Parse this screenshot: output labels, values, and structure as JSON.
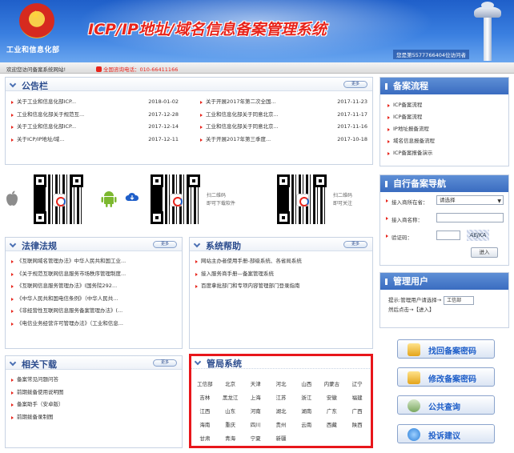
{
  "header": {
    "ministry": "工业和信息化部",
    "title": "ICP/IP地址/域名信息备案管理系统",
    "visitor_counter": "您是第5577766404位访问者"
  },
  "statusbar": {
    "welcome": "欢迎您访问备案系统网站!",
    "hotline_label": "全国咨询电话：",
    "hotline_number": "010-66411166"
  },
  "bulletin": {
    "title": "公告栏",
    "more": "更多",
    "left": [
      {
        "title": "关于工业和信息化部ICP...",
        "date": "2018-01-02"
      },
      {
        "title": "工业和信息化部关于规范互...",
        "date": "2017-12-28"
      },
      {
        "title": "关于工业和信息化部ICP...",
        "date": "2017-12-14"
      },
      {
        "title": "关于ICP/IP地址/域...",
        "date": "2017-12-11"
      }
    ],
    "right": [
      {
        "title": "关于开展2017年第二次全国...",
        "date": "2017-11-23"
      },
      {
        "title": "工业和信息化部关于同意北京...",
        "date": "2017-11-17"
      },
      {
        "title": "工业和信息化部关于同意北京...",
        "date": "2017-11-16"
      },
      {
        "title": "关于开展2017年第三季度...",
        "date": "2017-10-18"
      }
    ]
  },
  "qr": {
    "caption1_line1": "扫二维码",
    "caption1_line2": "即可下载软件",
    "caption2_line1": "扫二维码",
    "caption2_line2": "即可关注"
  },
  "laws": {
    "title": "法律法规",
    "more": "更多",
    "items": [
      "《互联网域名管理办法》中华人民共和国工业...",
      "《关于规范互联网信息服务市场秩序管理制度...",
      "《互联网信息服务管理办法》(国务院292...",
      "《中华人民共和国电信条例》（中华人民共...",
      "《非经营性互联网信息服务备案管理办法》(...",
      "《电信业务经营许可管理办法》（工业和信息..."
    ]
  },
  "help": {
    "title": "系统帮助",
    "more": "更多",
    "items": [
      "网站主办者使用手册-部级系统、各省局系统",
      "接入服务商手册—备案管理系统",
      "百度拿批部门和专项内容管理部门登录指南"
    ]
  },
  "downloads": {
    "title": "相关下载",
    "more": "更多",
    "items": [
      "备案常见问题问答",
      "前期拨备使用说明图",
      "备案助手（安卓版）",
      "前期拨备录制图"
    ]
  },
  "bureau": {
    "title": "管局系统",
    "provinces": [
      "工信部",
      "北京",
      "天津",
      "河北",
      "山西",
      "内蒙古",
      "辽宁",
      "吉林",
      "黑龙江",
      "上海",
      "江苏",
      "浙江",
      "安徽",
      "福建",
      "江西",
      "山东",
      "河南",
      "湖北",
      "湖南",
      "广东",
      "广西",
      "海南",
      "重庆",
      "四川",
      "贵州",
      "云南",
      "西藏",
      "陕西",
      "甘肃",
      "青海",
      "宁夏",
      "新疆"
    ]
  },
  "flow": {
    "title": "备案流程",
    "items": [
      "ICP备案流程",
      "ICP备案流程",
      "IP地址报备流程",
      "域名信息报备流程",
      "ICP备案报备演示"
    ]
  },
  "nav": {
    "title": "自行备案导航",
    "isp_label": "接入商所在省：",
    "isp_value": "请选择",
    "name_label": "接入商名称：",
    "captcha_label": "验证码：",
    "captcha_text": "AEJKA",
    "enter": "进入"
  },
  "users": {
    "title": "管理用户",
    "text_line1": "提示:管理用户请选择→",
    "select_value": "工信部",
    "text_line2": "然后点击→【进入】"
  },
  "actions": [
    {
      "label": "找回备案密码"
    },
    {
      "label": "修改备案密码"
    },
    {
      "label": "公共查询"
    },
    {
      "label": "投诉建议"
    }
  ]
}
